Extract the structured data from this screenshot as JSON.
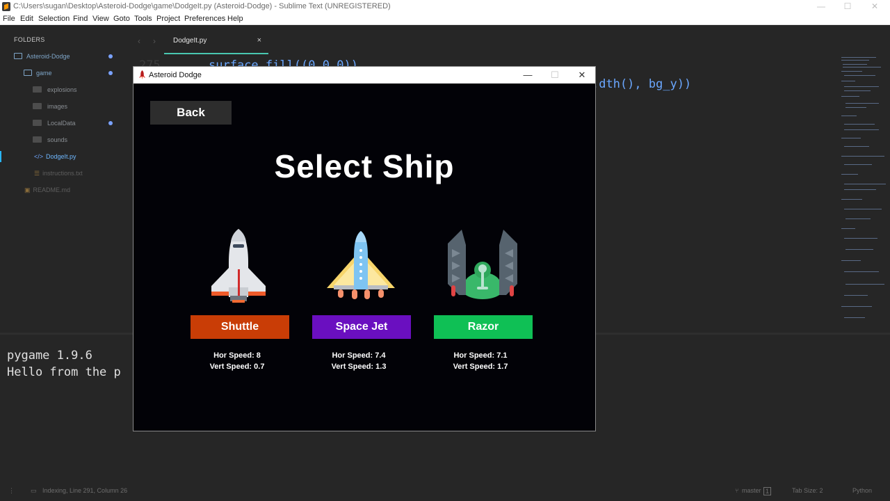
{
  "window": {
    "title": "C:\\Users\\sugan\\Desktop\\Asteroid-Dodge\\game\\DodgeIt.py (Asteroid-Dodge) - Sublime Text (UNREGISTERED)",
    "minimize": "—",
    "maximize": "☐",
    "close": "✕"
  },
  "menu": [
    "File",
    "Edit",
    "Selection",
    "Find",
    "View",
    "Goto",
    "Tools",
    "Project",
    "Preferences",
    "Help"
  ],
  "sidebar": {
    "header": "FOLDERS",
    "items": [
      {
        "label": "Asteroid-Dodge"
      },
      {
        "label": "game"
      },
      {
        "label": "explosions"
      },
      {
        "label": "images"
      },
      {
        "label": "LocalData"
      },
      {
        "label": "sounds"
      },
      {
        "label": "DodgeIt.py"
      },
      {
        "label": "instructions.txt"
      },
      {
        "label": "README.md"
      }
    ]
  },
  "tabs": {
    "prev": "‹",
    "next": "›",
    "active": "DodgeIt.py",
    "close": "×"
  },
  "editor": {
    "line_number": "275",
    "line1": "surface.fill((0,0,0))",
    "line2": ".dth(), bg_y))"
  },
  "console": {
    "lines": [
      "pygame 1.9.6",
      "Hello from the p"
    ]
  },
  "statusbar": {
    "left": "Indexing, Line 291, Column 26",
    "branch": "master",
    "branch_count": "1",
    "tab_size": "Tab Size: 2",
    "syntax": "Python"
  },
  "game": {
    "title": "Asteroid Dodge",
    "minimize": "—",
    "maximize": "☐",
    "close": "✕",
    "back": "Back",
    "heading": "Select Ship",
    "ships": [
      {
        "name": "Shuttle",
        "color": "#c93d06",
        "hor": "Hor Speed: 8",
        "vert": "Vert Speed: 0.7"
      },
      {
        "name": "Space Jet",
        "color": "#6a0fc0",
        "hor": "Hor Speed: 7.4",
        "vert": "Vert Speed: 1.3"
      },
      {
        "name": "Razor",
        "color": "#0fc055",
        "hor": "Hor Speed: 7.1",
        "vert": "Vert Speed: 1.7"
      }
    ]
  },
  "colors": {
    "editor_bg": "#262626",
    "accent_tab": "#49c7b0",
    "code_blue": "#6aa7ff",
    "modified_dot": "#7aa2ff"
  }
}
